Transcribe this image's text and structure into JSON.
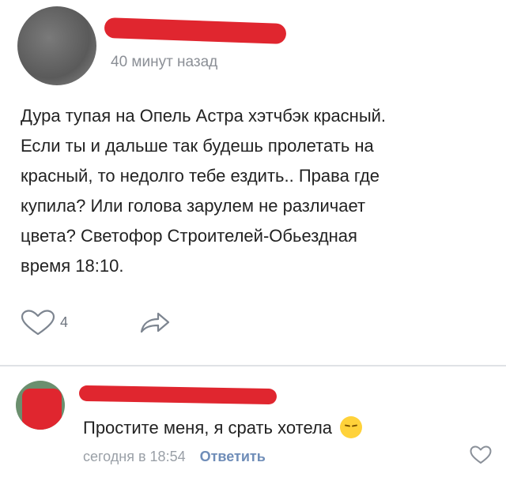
{
  "post": {
    "time": "40 минут назад",
    "text_lines": [
      "Дура тупая на Опель Астра хэтчбэк красный.",
      "Если ты и дальше так будешь пролетать на",
      "красный, то недолго тебе ездить.. Права где",
      "купила? Или голова зарулем не различает",
      "цвета? Светофор Строителей-Обьездная",
      "время 18:10."
    ],
    "likes": "4"
  },
  "comment": {
    "text": "Простите меня, я срать хотела",
    "time": "сегодня в 18:54",
    "reply_label": "Ответить"
  },
  "colors": {
    "redaction": "#e0262f",
    "link": "#6f8db8",
    "muted": "#9aa0a7"
  },
  "icons": {
    "like": "heart-outline-icon",
    "share": "share-arrow-icon",
    "emoji": "pensive-face-emoji"
  }
}
